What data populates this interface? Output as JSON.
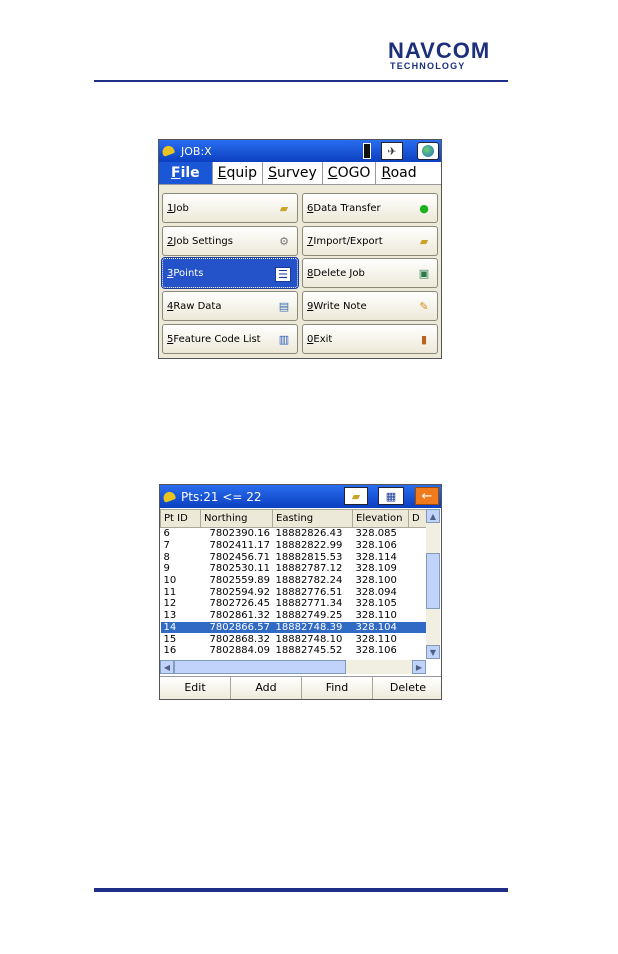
{
  "header": {
    "logo_line1": "NAVCOM",
    "logo_line2": "TECHNOLOGY"
  },
  "screen1": {
    "title": "JOB:X",
    "menu": [
      {
        "key": "F",
        "rest": "ile"
      },
      {
        "key": "E",
        "rest": "quip"
      },
      {
        "key": "S",
        "rest": "urvey"
      },
      {
        "key": "C",
        "rest": "OGO"
      },
      {
        "key": "R",
        "rest": "oad"
      }
    ],
    "buttons": [
      {
        "num": "1",
        "label": " Job",
        "icon": "folder-open-icon"
      },
      {
        "num": "6",
        "label": " Data Transfer",
        "icon": "green-ball-icon"
      },
      {
        "num": "2",
        "label": " Job Settings",
        "icon": "settings-icon"
      },
      {
        "num": "7",
        "label": " Import/Export",
        "icon": "folder-export-icon"
      },
      {
        "num": "3",
        "label": " Points",
        "icon": "list-icon"
      },
      {
        "num": "8",
        "label": " Delete Job",
        "icon": "trash-icon"
      },
      {
        "num": "4",
        "label": " Raw Data",
        "icon": "raw-data-icon"
      },
      {
        "num": "9",
        "label": " Write Note",
        "icon": "pencil-icon"
      },
      {
        "num": "5",
        "label": " Feature Code List",
        "icon": "book-icon"
      },
      {
        "num": "0",
        "label": " Exit",
        "icon": "exit-door-icon"
      }
    ]
  },
  "screen2": {
    "title": "Pts:21 <= 22",
    "columns": [
      "Pt ID",
      "Northing",
      "Easting",
      "Elevation",
      "D"
    ],
    "rows": [
      [
        "6",
        "7802390.16",
        "18882826.43",
        "328.085"
      ],
      [
        "7",
        "7802411.17",
        "18882822.99",
        "328.106"
      ],
      [
        "8",
        "7802456.71",
        "18882815.53",
        "328.114"
      ],
      [
        "9",
        "7802530.11",
        "18882787.12",
        "328.109"
      ],
      [
        "10",
        "7802559.89",
        "18882782.24",
        "328.100"
      ],
      [
        "11",
        "7802594.92",
        "18882776.51",
        "328.094"
      ],
      [
        "12",
        "7802726.45",
        "18882771.34",
        "328.105"
      ],
      [
        "13",
        "7802861.32",
        "18882749.25",
        "328.110"
      ],
      [
        "14",
        "7802866.57",
        "18882748.39",
        "328.104"
      ],
      [
        "15",
        "7802868.32",
        "18882748.10",
        "328.110"
      ],
      [
        "16",
        "7802884.09",
        "18882745.52",
        "328.106"
      ]
    ],
    "selected_row": "14",
    "bottom_buttons": [
      "Edit",
      "Add",
      "Find",
      "Delete"
    ]
  }
}
